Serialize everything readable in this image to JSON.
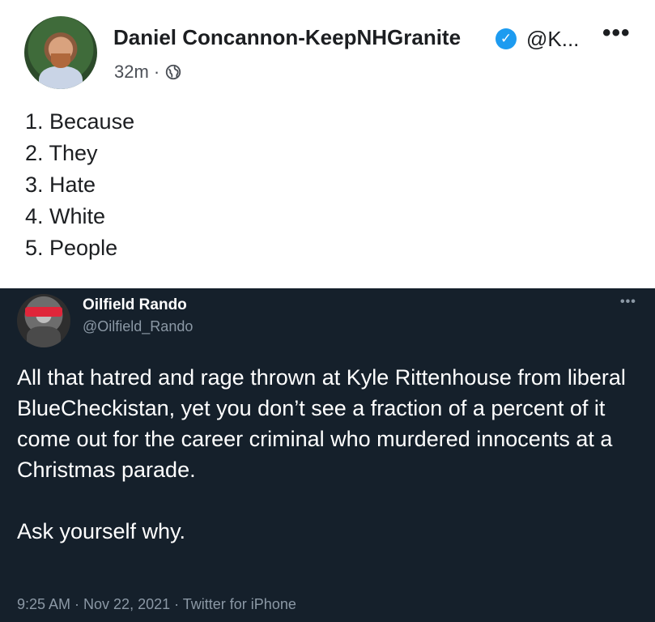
{
  "facebook_post": {
    "author_name": "Daniel Concannon-KeepNHGranite",
    "verified_icon": "check-badge-icon",
    "handle_truncated": "@K...",
    "more_label": "•••",
    "time": "32m ·",
    "audience_icon": "globe-icon",
    "list_items": [
      "1. Because",
      "2. They",
      "3. Hate",
      "4. White",
      "5. People"
    ]
  },
  "tweet": {
    "author_name": "Oilfield Rando",
    "handle": "@Oilfield_Rando",
    "more_label": "•••",
    "body": "All that hatred and rage thrown at Kyle Rittenhouse from liberal BlueCheckistan, yet you don’t see a fraction of a percent of it come out for the career criminal who murdered innocents at a Christmas parade.\n\nAsk yourself why.",
    "footer": "9:25 AM · Nov 22, 2021 · Twitter for iPhone"
  },
  "colors": {
    "light_bg": "#ffffff",
    "dark_bg": "#15202b",
    "verified_blue": "#1d9bf0",
    "muted_text": "#8b98a5"
  }
}
